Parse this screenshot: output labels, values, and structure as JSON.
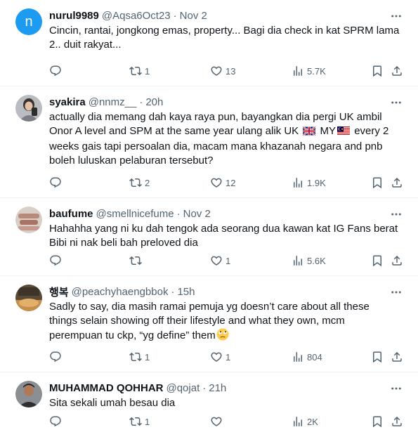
{
  "tweets": [
    {
      "name": "nurul9989",
      "handle": "@Aqsa6Oct23",
      "dot": "·",
      "time": "Nov 2",
      "avatar_letter": "n",
      "text": "Cincin, rantai, jongkong emas, property... Bagi dia check in kat SPRM lama 2.. duit rakyat...",
      "retweets": "1",
      "likes": "13",
      "views": "5.7K"
    },
    {
      "name": "syakira",
      "handle": "@nnmz__",
      "dot": "·",
      "time": "20h",
      "text_a": "actually dia memang dah kaya raya pun, bayangkan dia pergi UK ambil Onor A level and SPM at the same year ulang alik UK ",
      "text_b": " MY",
      "text_c": " every 2 weeks gais tapi persoalan dia, macam mana khazanah negara and pnb boleh luluskan pelaburan tersebut?",
      "retweets": "2",
      "likes": "12",
      "views": "1.9K"
    },
    {
      "name": "baufume",
      "handle": "@smellnicefume",
      "dot": "·",
      "time": "Nov 2",
      "text": "Hahahha yang ni ku dah tengok ada seorang dua kawan kat IG Fans berat Bibi ni nak beli bah preloved dia",
      "retweets": "",
      "likes": "1",
      "views": "5.6K"
    },
    {
      "name": "행복",
      "handle": "@peachyhaengbbok",
      "dot": "·",
      "time": "15h",
      "text": "Sadly to say, dia masih ramai pemuja yg doesn’t care about all these things selain showing off their lifestyle and what they own, mcm perempuan tu ckp, “yg define” them",
      "retweets": "1",
      "likes": "1",
      "views": "804"
    },
    {
      "name": "MUHAMMAD QOHHAR",
      "handle": "@qojat",
      "dot": "·",
      "time": "21h",
      "text": "Sita sekali umah besau dia",
      "retweets": "1",
      "likes": "",
      "views": "2K"
    }
  ],
  "icons": {
    "reply": "reply-icon",
    "retweet": "retweet-icon",
    "like": "like-icon",
    "views": "views-icon",
    "bookmark": "bookmark-icon",
    "share": "share-icon",
    "more": "more-options-icon"
  },
  "colors": {
    "text": "#0f1419",
    "secondary": "#536471",
    "divider": "#eff3f4",
    "avatar_default": "#1d9bf0"
  }
}
